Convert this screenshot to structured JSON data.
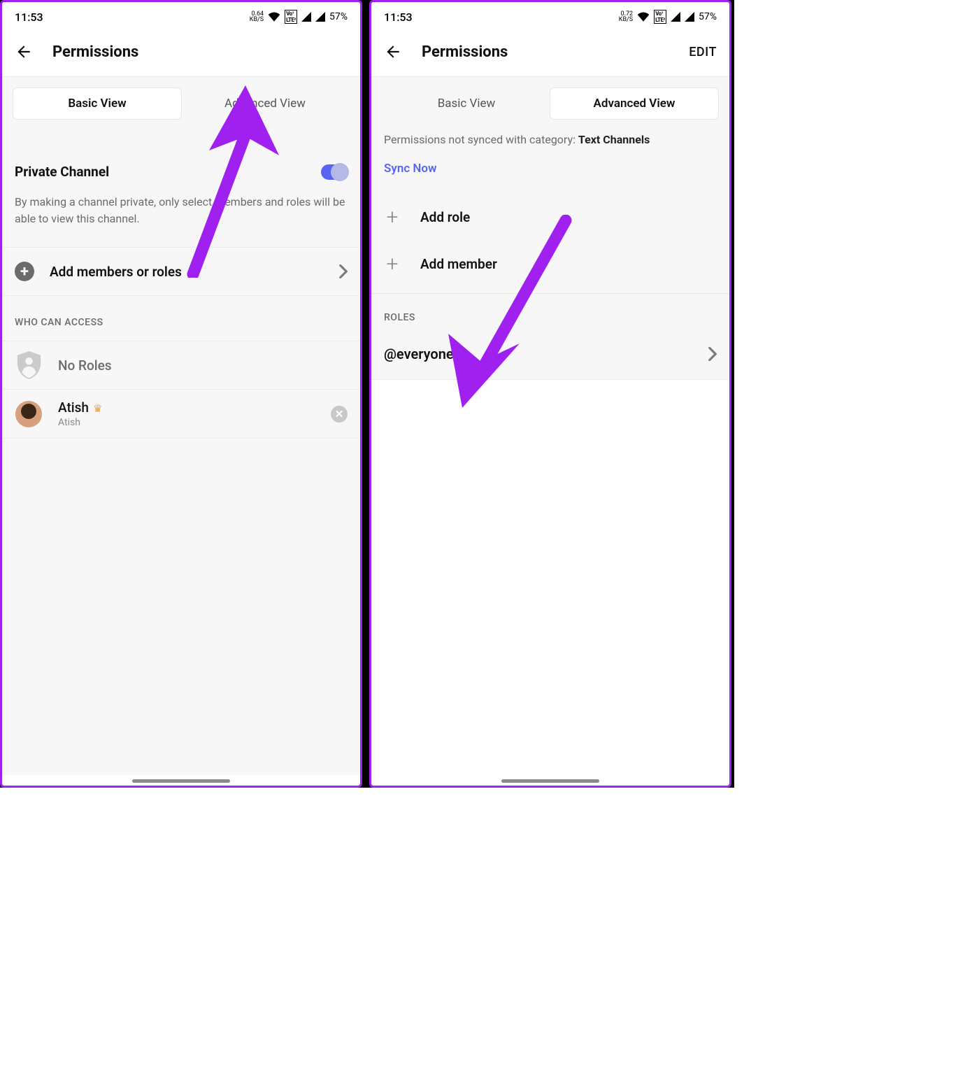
{
  "status": {
    "time": "11:53",
    "kbs1": "0.64",
    "kbs2": "0.72",
    "kbs_unit": "KB/S",
    "lte": "Vo 1\nLTE 2",
    "battery": "57%"
  },
  "header": {
    "title": "Permissions",
    "edit": "EDIT"
  },
  "tabs": {
    "basic": "Basic View",
    "advanced": "Advanced View"
  },
  "basic": {
    "private_label": "Private Channel",
    "private_desc": "By making a channel private, only select members and roles will be able to view this channel.",
    "add_members_roles": "Add members or roles",
    "who_header": "WHO CAN ACCESS",
    "no_roles": "No Roles",
    "member": {
      "name": "Atish",
      "sub": "Atish"
    }
  },
  "advanced": {
    "sync_msg_prefix": "Permissions not synced with category: ",
    "sync_msg_cat": "Text Channels",
    "sync_now": "Sync Now",
    "add_role": "Add role",
    "add_member": "Add member",
    "roles_header": "ROLES",
    "everyone": "@everyone"
  }
}
